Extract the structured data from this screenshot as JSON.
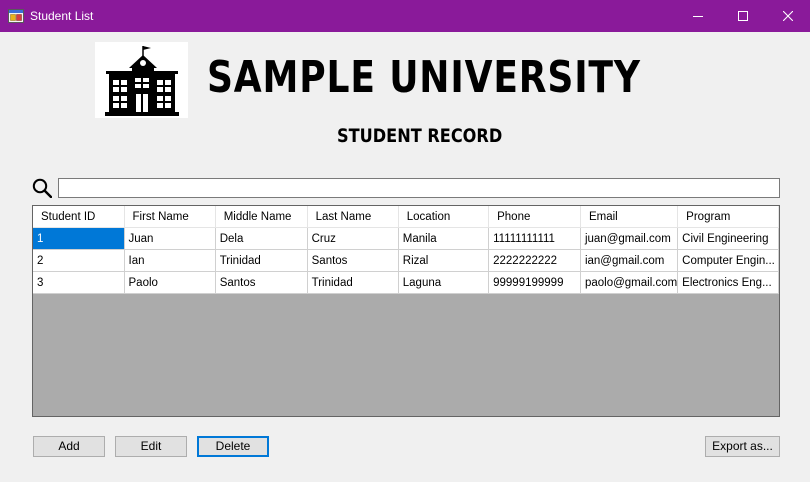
{
  "window": {
    "title": "Student List",
    "accent": "#8a1a9a",
    "controls": [
      "minimize-icon",
      "maximize-icon",
      "close-icon"
    ]
  },
  "header": {
    "logo_icon": "university-building-icon",
    "title": "SAMPLE UNIVERSITY",
    "subtitle": "STUDENT RECORD"
  },
  "search": {
    "icon": "search-icon",
    "value": "",
    "placeholder": ""
  },
  "table": {
    "columns": [
      "Student ID",
      "First Name",
      "Middle Name",
      "Last Name",
      "Location",
      "Phone",
      "Email",
      "Program"
    ],
    "rows": [
      [
        "1",
        "Juan",
        "Dela",
        "Cruz",
        "Manila",
        "11111111111",
        "juan@gmail.com",
        "Civil Engineering"
      ],
      [
        "2",
        "Ian",
        "Trinidad",
        "Santos",
        "Rizal",
        "2222222222",
        "ian@gmail.com",
        "Computer Engin..."
      ],
      [
        "3",
        "Paolo",
        "Santos",
        "Trinidad",
        "Laguna",
        "99999199999",
        "paolo@gmail.com",
        "Electronics Eng..."
      ]
    ],
    "selection_color": "#0078d7"
  },
  "buttons": {
    "add": "Add",
    "edit": "Edit",
    "delete": "Delete",
    "export": "Export as..."
  }
}
